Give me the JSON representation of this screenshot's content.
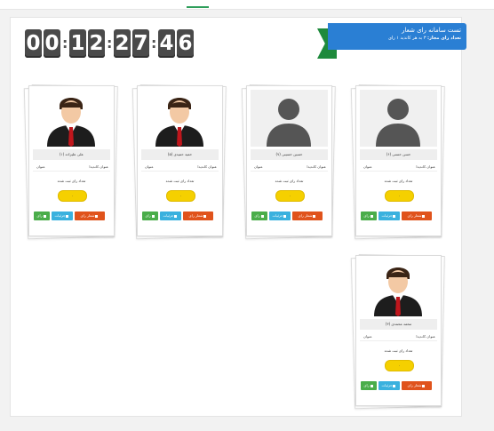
{
  "countdown": {
    "digits": [
      "0",
      "0",
      "1",
      "2",
      "2",
      "7",
      "4",
      "6"
    ],
    "colon": ":"
  },
  "header": {
    "title": "تست سامانه رای شعار",
    "subtitle_bold": "تعداد رای مجاز:",
    "subtitle_rest": "۳ به هر کاندید ۱ رای"
  },
  "labels": {
    "info_label": "عنوان کاندیدا",
    "info_value": "عنوان",
    "votes_label": "تعداد رای ثبت شده",
    "vote_button": "شعار رای",
    "details_button": "جزئیات",
    "rai_button": "رای"
  },
  "candidates": [
    {
      "name": "حسن حسنی (۶)",
      "votes": "۰",
      "photo": "silhouette"
    },
    {
      "name": "حسین حسینی (۷)",
      "votes": "۰",
      "photo": "silhouette"
    },
    {
      "name": "حمید حمیدی (۵)",
      "votes": "۰",
      "photo": "businessman"
    },
    {
      "name": "علی علیزاده (۱)",
      "votes": "۰",
      "photo": "businessman"
    },
    {
      "name": "محمد محمدی (۳)",
      "votes": "۰",
      "photo": "businessman"
    }
  ],
  "colors": {
    "ribbon": "#2a7fd4",
    "ribbon_tail": "#1e8a3c",
    "vote_pill": "#f5d000",
    "btn_vote": "#e0531c",
    "btn_details": "#3ab1de",
    "btn_rai": "#4aad4a",
    "digit_bg": "#4a4a4a"
  }
}
